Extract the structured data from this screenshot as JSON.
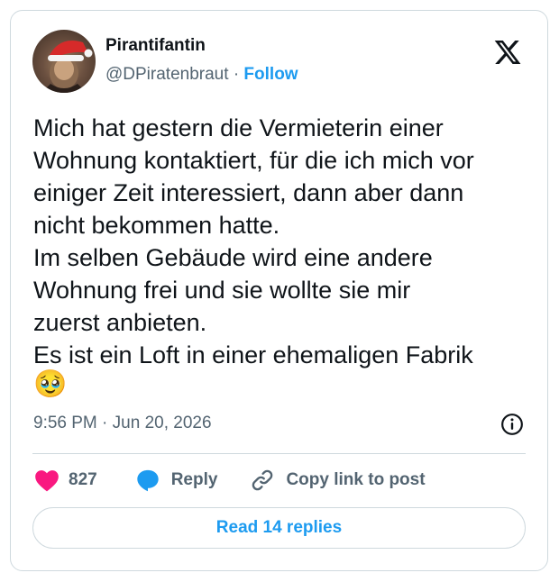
{
  "author": {
    "display_name": "Pirantifantin",
    "handle": "@DPiratenbraut",
    "separator": "·",
    "follow_label": "Follow",
    "avatar_icon": "santa-hat-avatar"
  },
  "post": {
    "text": "Mich hat gestern die Vermieterin einer\nWohnung kontaktiert, für die ich mich vor\neiniger Zeit interessiert, dann aber dann\nnicht bekommen hatte.\nIm selben Gebäude wird eine andere\nWohnung frei und sie wollte sie mir\nzuerst anbieten.\nEs ist ein Loft in einer ehemaligen Fabrik",
    "emoji": "🥹",
    "time": "9:56 PM",
    "date_separator": "·",
    "date": "Jun 20, 2026"
  },
  "actions": {
    "like_count": "827",
    "reply_label": "Reply",
    "copy_label": "Copy link to post"
  },
  "read_replies_label": "Read 14 replies",
  "icons": {
    "brand": "x-logo-icon",
    "info": "info-icon",
    "like": "heart-icon",
    "reply": "speech-bubble-icon",
    "copy": "link-icon"
  },
  "colors": {
    "accent": "#1d9bf0",
    "like": "#f91880",
    "text": "#0f1419",
    "secondary": "#536471",
    "border": "#cfd9de"
  }
}
